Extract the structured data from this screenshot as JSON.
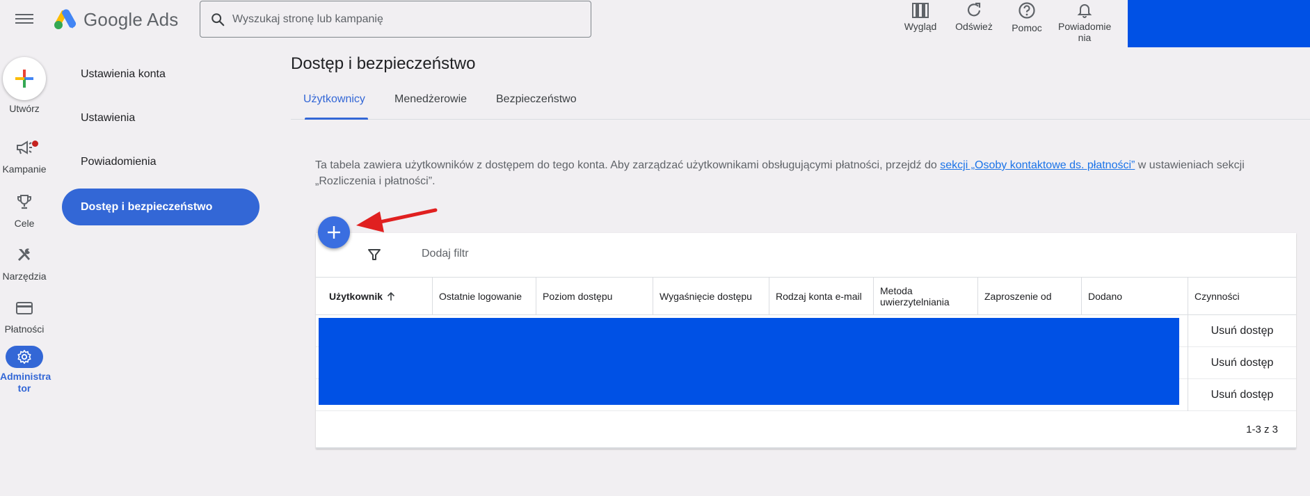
{
  "app": {
    "logo_text": "Google Ads"
  },
  "search": {
    "placeholder": "Wyszukaj stronę lub kampanię"
  },
  "toolbar": {
    "appearance_label": "Wygląd",
    "refresh_label": "Odśwież",
    "help_label": "Pomoc",
    "notifications_label_line1": "Powiadomie",
    "notifications_label_line2": "nia"
  },
  "rail": {
    "create_label": "Utwórz",
    "campaigns_label": "Kampanie",
    "goals_label": "Cele",
    "tools_label": "Narzędzia",
    "billing_label": "Płatności",
    "admin_label_line1": "Administra",
    "admin_label_line2": "tor"
  },
  "subnav": {
    "items": [
      {
        "label": "Ustawienia konta"
      },
      {
        "label": "Ustawienia"
      },
      {
        "label": "Powiadomienia"
      },
      {
        "label": "Dostęp i bezpieczeństwo"
      }
    ]
  },
  "main": {
    "title": "Dostęp i bezpieczeństwo",
    "tabs": [
      {
        "label": "Użytkownicy"
      },
      {
        "label": "Menedżerowie"
      },
      {
        "label": "Bezpieczeństwo"
      }
    ],
    "info_text_1": "Ta tabela zawiera użytkowników z dostępem do tego konta. Aby zarządzać użytkownikami obsługującymi płatności, przejdź do ",
    "info_link": "sekcji „Osoby kontaktowe ds. płatności”",
    "info_text_2": " w ustawieniach sekcji „Rozliczenia i płatności”.",
    "filter_label": "Dodaj filtr",
    "columns": [
      "Użytkownik",
      "Ostatnie logowanie",
      "Poziom dostępu",
      "Wygaśnięcie dostępu",
      "Rodzaj konta e-mail",
      "Metoda uwierzytelniania",
      "Zaproszenie od",
      "Dodano",
      "Czynności"
    ],
    "rows": [
      {
        "action": "Usuń dostęp"
      },
      {
        "action": "Usuń dostęp"
      },
      {
        "action": "Usuń dostęp"
      }
    ],
    "pager": "1-3 z 3"
  },
  "colors": {
    "accent": "#3367d6",
    "redaction": "#0051e5",
    "arrow": "#e02020"
  },
  "icons": [
    "menu-icon",
    "google-ads-logo",
    "search-icon",
    "appearance-icon",
    "refresh-icon",
    "help-icon",
    "bell-icon",
    "plus-icon",
    "megaphone-icon",
    "trophy-icon",
    "tools-icon",
    "credit-card-icon",
    "gear-icon",
    "filter-icon",
    "sort-up-icon",
    "red-arrow"
  ]
}
